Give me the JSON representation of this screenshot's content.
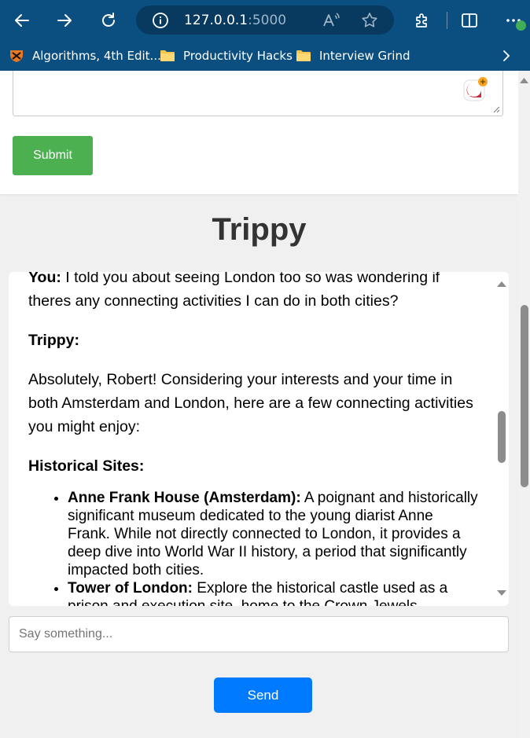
{
  "browser": {
    "url_host": "127.0.0.1",
    "url_port": ":5000",
    "bookmarks": [
      {
        "label": "Algorithms, 4th Edit...",
        "icon": "princeton-shield-icon"
      },
      {
        "label": "Productivity Hacks",
        "icon": "folder-icon"
      },
      {
        "label": "Interview Grind",
        "icon": "folder-icon"
      }
    ],
    "extension_badge_count": "1"
  },
  "form": {
    "submit_label": "Submit"
  },
  "chat": {
    "title": "Trippy",
    "you_label": "You:",
    "you_message": " I told you about seeing London too so was wondering if theres any connecting activities I can do in both cities?",
    "trippy_label": "Trippy:",
    "reply_intro": "Absolutely, Robert! Considering your interests and your time in both Amsterdam and London, here are a few connecting activities you might enjoy:",
    "section_heading": "Historical Sites:",
    "items": [
      {
        "title": "Anne Frank House (Amsterdam):",
        "text": " A poignant and historically significant museum dedicated to the young diarist Anne Frank. While not directly connected to London, it provides a deep dive into World War II history, a period that significantly impacted both cities."
      },
      {
        "title": "Tower of London:",
        "text": " Explore the historical castle used as a prison and execution site, home to the Crown Jewels."
      }
    ]
  },
  "input": {
    "placeholder": "Say something...",
    "send_label": "Send"
  }
}
